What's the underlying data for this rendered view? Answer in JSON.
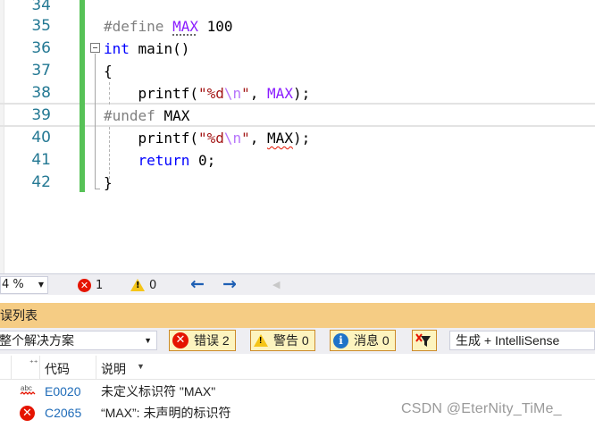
{
  "editor": {
    "lines": [
      {
        "num": "34"
      },
      {
        "num": "35"
      },
      {
        "num": "36"
      },
      {
        "num": "37"
      },
      {
        "num": "38"
      },
      {
        "num": "39"
      },
      {
        "num": "40"
      },
      {
        "num": "41"
      },
      {
        "num": "42"
      }
    ],
    "tokens": {
      "define": "#define",
      "max_macro": "MAX",
      "hundred": "100",
      "int_kw": "int",
      "main_call": "main()",
      "open_brace": "{",
      "printf": "printf(",
      "str_open": "\"%d",
      "str_esc": "\\n",
      "str_close": "\"",
      "comma_sp": ", ",
      "close_call": ");",
      "undef": "#undef",
      "undef_name": "MAX",
      "return_kw": "return",
      "return_val": "0;",
      "close_brace": "}"
    }
  },
  "status_strip": {
    "zoom": "4 %",
    "error_count": "1",
    "warning_count": "0",
    "nav_back": "←",
    "nav_forward": "→"
  },
  "error_list": {
    "title": "误列表",
    "scope": "整个解决方案",
    "errors_label": "错误 2",
    "warnings_label": "警告 0",
    "messages_label": "消息 0",
    "build_source": "生成 + IntelliSense",
    "columns": {
      "code": "代码",
      "description": "说明"
    },
    "rows": [
      {
        "icon": "spelling-abc-icon",
        "code": "E0020",
        "description": "未定义标识符 \"MAX\""
      },
      {
        "icon": "error-icon",
        "code": "C2065",
        "description": "“MAX”: 未声明的标识符"
      }
    ]
  },
  "watermark": "CSDN @EterNity_TiMe_",
  "colors": {
    "change_bar": "#57c257",
    "error_red": "#e51400",
    "panel_title_bg": "#f5cc84",
    "link_blue": "#1e6bb8"
  }
}
